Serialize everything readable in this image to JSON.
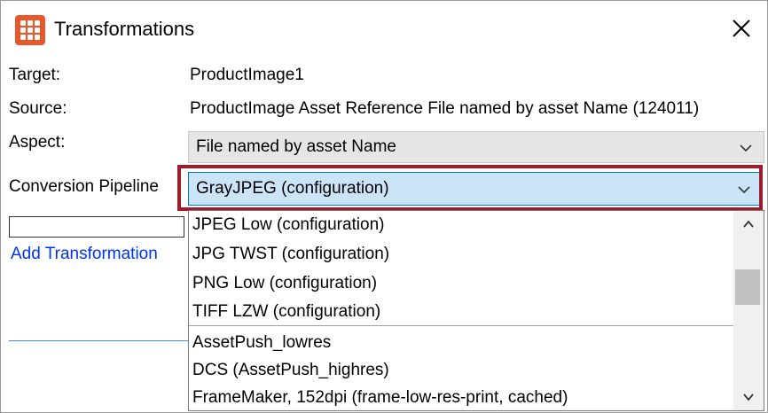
{
  "window": {
    "title": "Transformations",
    "app_icon": "grid-logo-icon",
    "close_icon": "close-icon",
    "accent_color": "#e8562a"
  },
  "fields": {
    "target_label": "Target:",
    "target_value": "ProductImage1",
    "source_label": "Source:",
    "source_value": "ProductImage Asset Reference File named by asset Name (124011)",
    "aspect_label": "Aspect:",
    "aspect_value": "File named by asset Name",
    "pipeline_label": "Conversion Pipeline",
    "pipeline_value": "GrayJPEG (configuration)"
  },
  "actions": {
    "add_transformation": "Add Transformation"
  },
  "dropdown": {
    "items_top": [
      "JPEG Low (configuration)",
      "JPG TWST (configuration)",
      "PNG Low (configuration)",
      "TIFF LZW (configuration)"
    ],
    "items_bottom": [
      "AssetPush_lowres",
      "DCS (AssetPush_highres)",
      "FrameMaker, 152dpi (frame-low-res-print, cached)"
    ]
  },
  "colors": {
    "highlight_border": "#9e1b2c",
    "selected_bg": "#cce4f7",
    "link": "#0033ee"
  }
}
